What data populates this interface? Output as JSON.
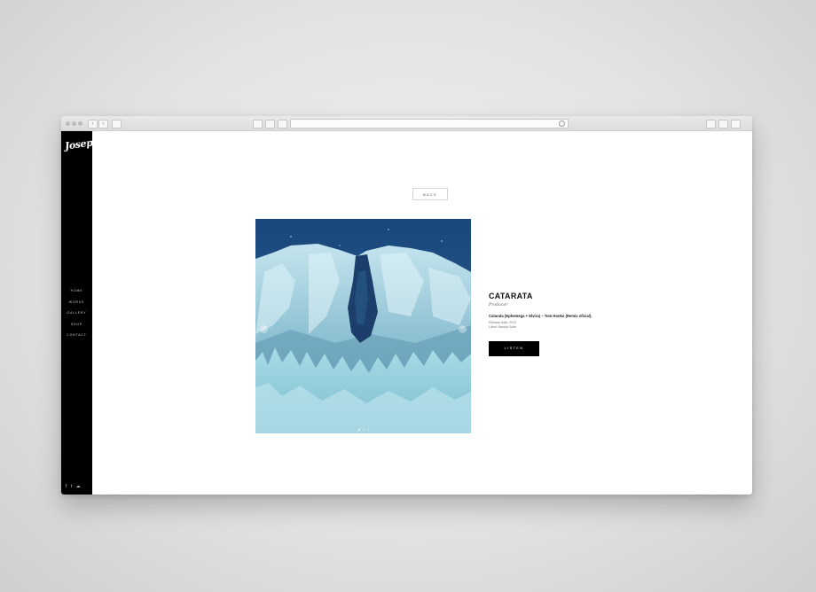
{
  "browser": {
    "toolbar_icons": [
      "back-arrow-icon",
      "forward-arrow-icon",
      "sidebar-toggle-icon",
      "bookmarks-icon",
      "reading-list-icon",
      "home-icon",
      "share-icon",
      "tabs-icon",
      "download-icon"
    ]
  },
  "sidebar": {
    "logo": "Joseph",
    "nav": [
      "HOME",
      "WORKS",
      "GALLERY",
      "SHOP",
      "CONTACT"
    ],
    "social": [
      "f",
      "t",
      "☁"
    ]
  },
  "content": {
    "back_label": "BACK",
    "artwork": {
      "description_icon": "waterfall-artwork",
      "arrows": [
        "‹",
        "›"
      ]
    },
    "title": "CATARATA",
    "role": "Producer",
    "track": "Catarata (Ephemega + Elvira) – Tom Honko (Remix oficial).",
    "release": "Release date: 2015",
    "label": "Label: Nacrija Suite",
    "listen_label": "LISTEN"
  },
  "colors": {
    "sidebar_bg": "#000000",
    "page_bg": "#ffffff",
    "artwork_sky": "#1f4f86",
    "artwork_ice": "#9fd2df",
    "button_bg": "#000000"
  }
}
